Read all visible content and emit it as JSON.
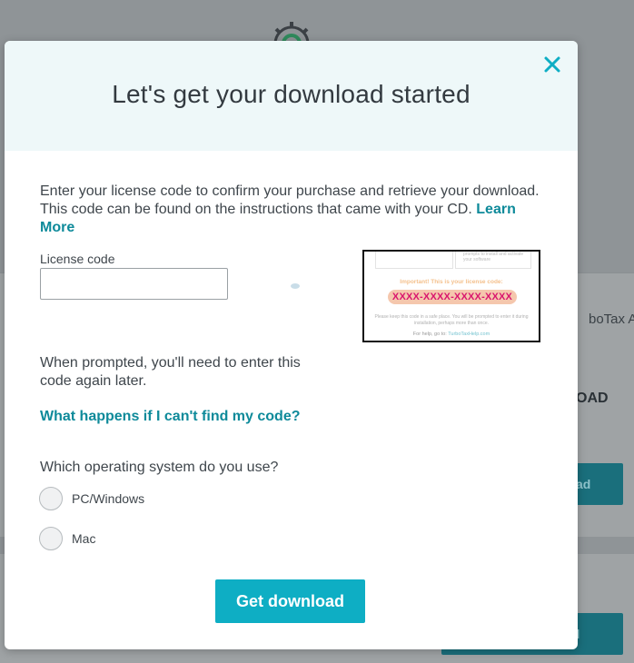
{
  "background": {
    "partial_text_a": "boTax Ad",
    "partial_text_b": "OAD",
    "partial_button_1": "ad",
    "partial_button_2": "ad"
  },
  "modal": {
    "title": "Let's get your download started",
    "intro_text": "Enter your license code to confirm your purchase and retrieve your download. This code can be found on the instructions that came with your CD.",
    "learn_more_label": "Learn More",
    "license_label": "License code",
    "license_value": "",
    "license_image": {
      "install_hint": "prompts to install and activate your software",
      "important_text": "Important! This is your license code:",
      "code": "XXXX-XXXX-XXXX-XXXX",
      "keep_text": "Please keep this code in a safe place. You will be prompted to enter it during installation, perhaps more than once.",
      "help_prefix": "For help, go to:",
      "help_link": "TurboTaxHelp.com"
    },
    "prompt_text": "When prompted, you'll need to enter this code again later.",
    "cant_find_link": "What happens if I can't find my code?",
    "os_question": "Which operating system do you use?",
    "os_options": [
      "PC/Windows",
      "Mac"
    ],
    "get_download_label": "Get download"
  },
  "colors": {
    "accent": "#0eaec4",
    "link": "#0e8a9a",
    "header_bg": "#eef8f9",
    "code_highlight": "#f5c7ad",
    "code_text": "#d9156e"
  },
  "icons": {
    "close": "close-icon",
    "arrow": "arrow-icon",
    "gear": "gear-icon"
  }
}
